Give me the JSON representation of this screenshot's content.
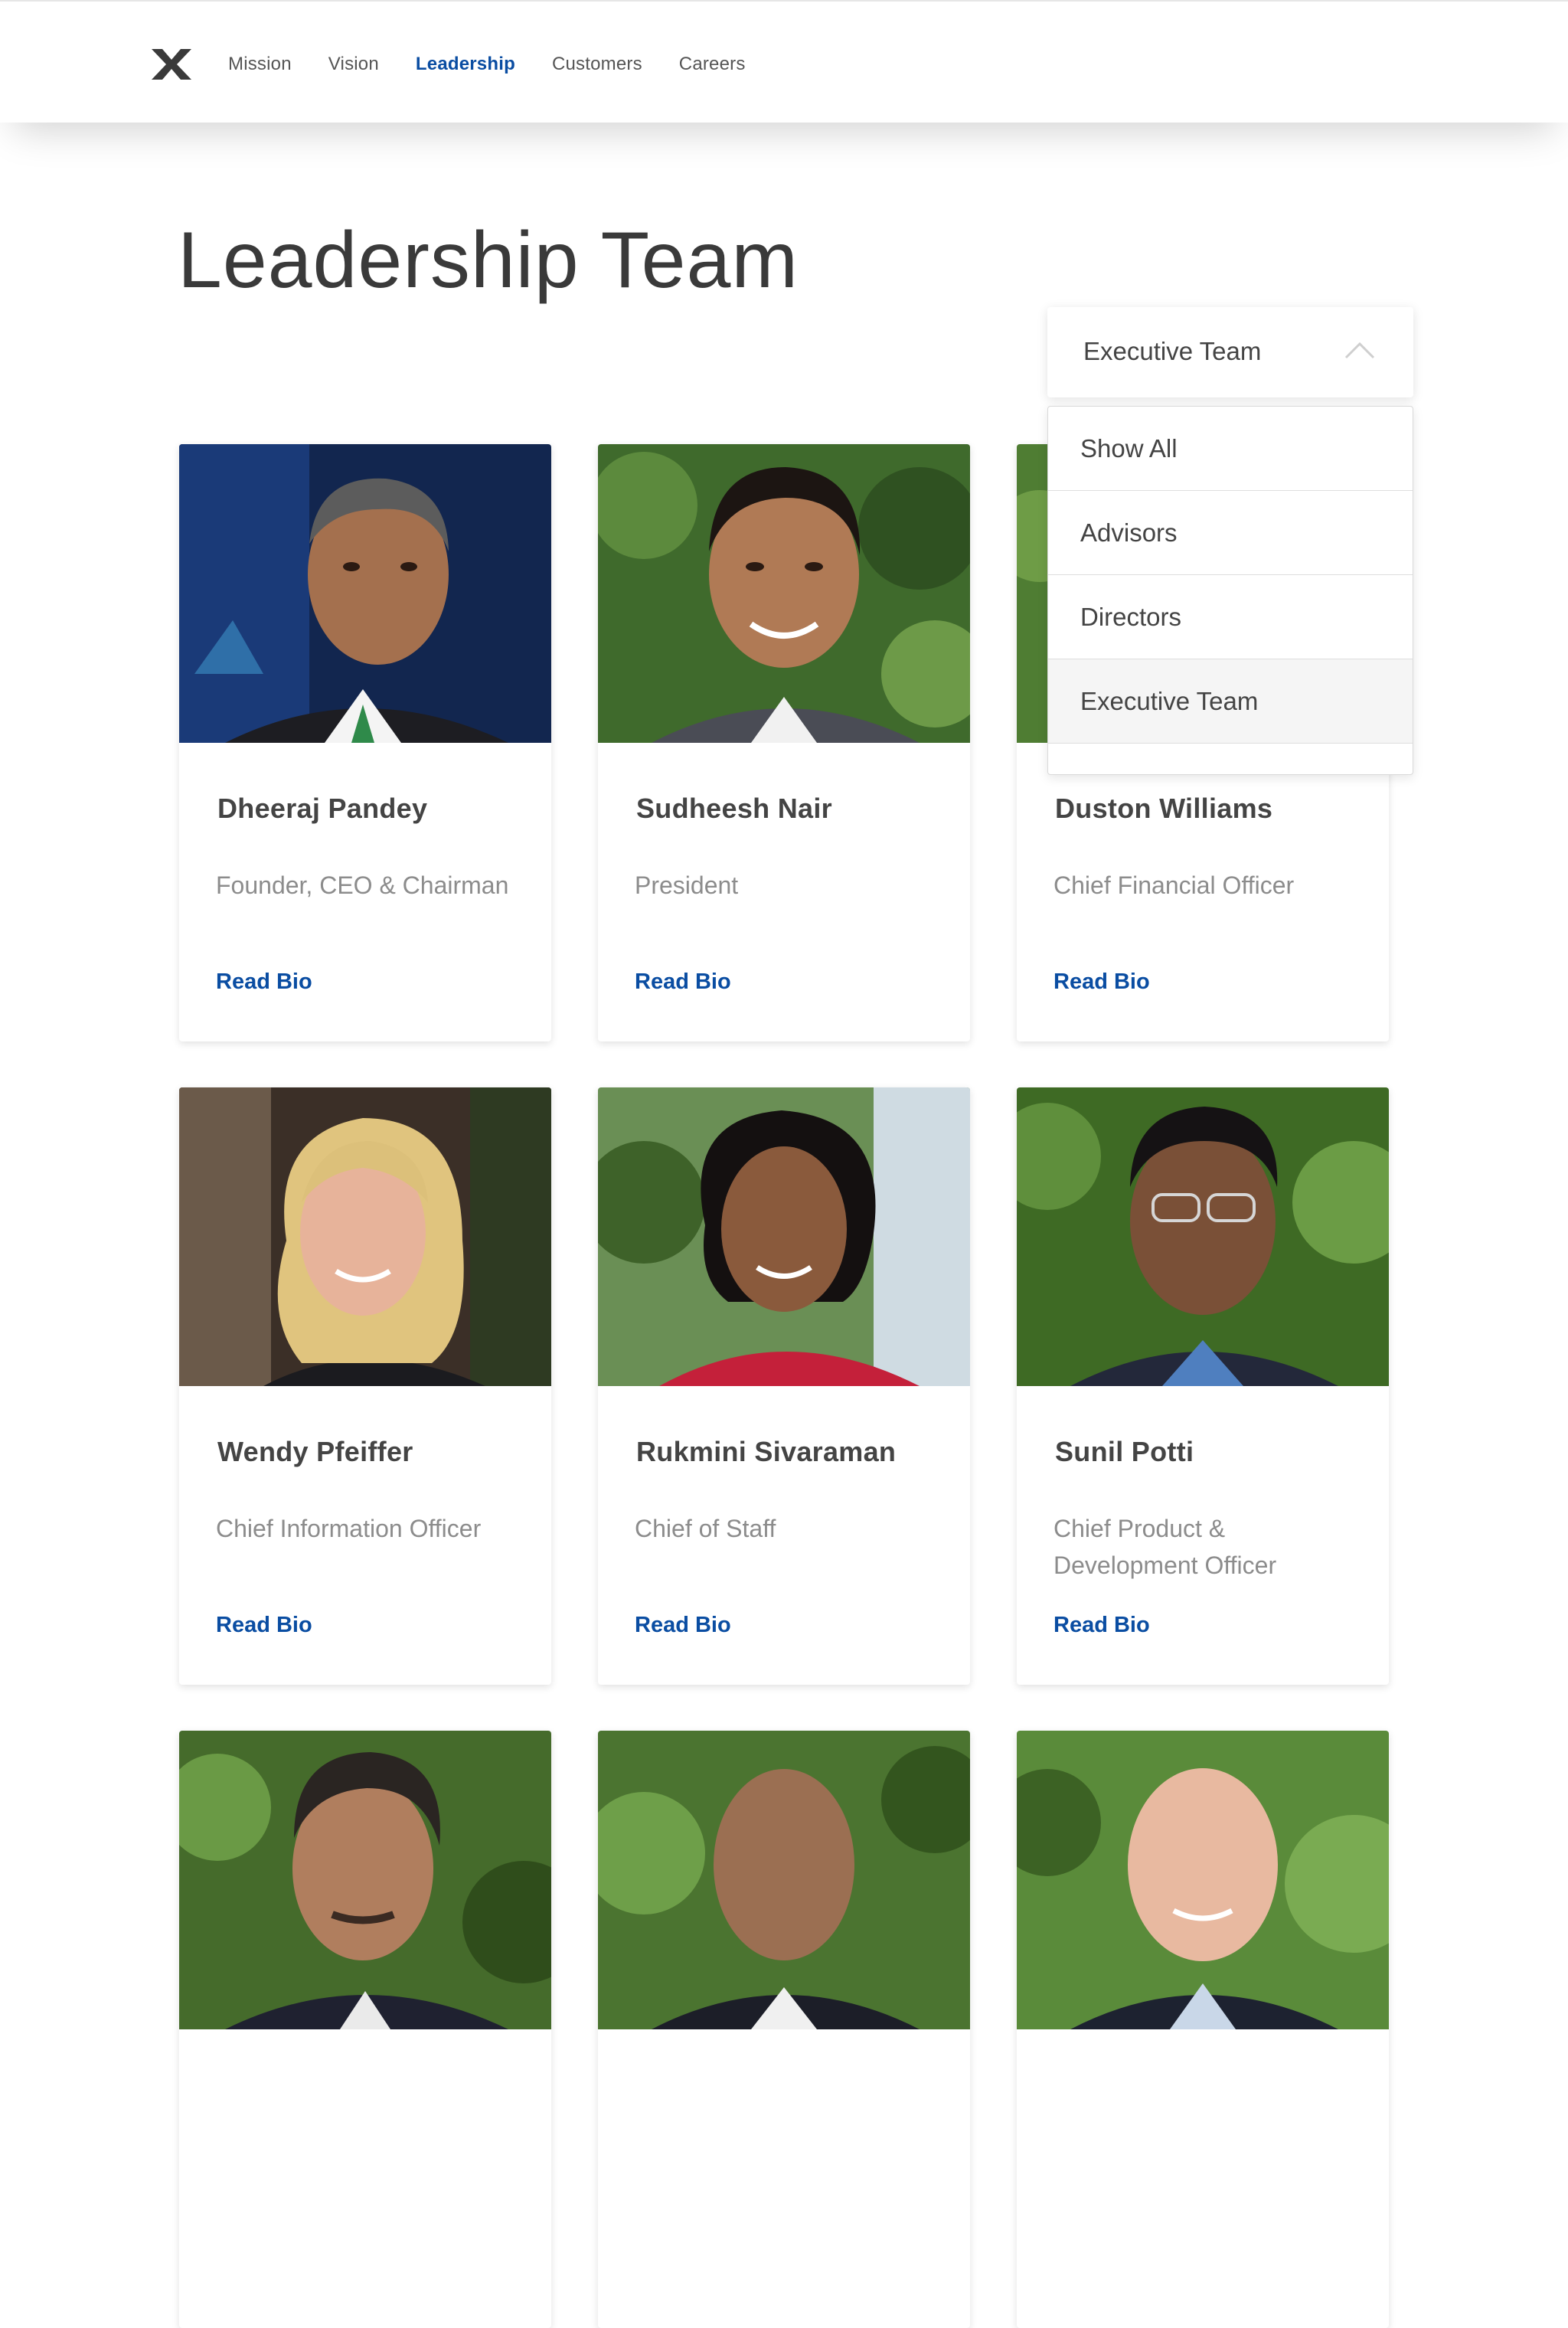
{
  "nav": {
    "logo": "nutanix-x-logo",
    "links": [
      "Mission",
      "Vision",
      "Leadership",
      "Customers",
      "Careers"
    ],
    "active": "Leadership"
  },
  "page": {
    "title": "Leadership Team"
  },
  "filter": {
    "selected": "Executive Team",
    "options": [
      "Show All",
      "Advisors",
      "Directors",
      "Executive Team"
    ],
    "icon": "chevron-up-icon"
  },
  "team": [
    {
      "name": "Dheeraj Pandey",
      "role": "Founder, CEO & Chairman",
      "link": "Read Bio"
    },
    {
      "name": "Sudheesh Nair",
      "role": "President",
      "link": "Read Bio"
    },
    {
      "name": "Duston Williams",
      "role": "Chief Financial Officer",
      "link": "Read Bio"
    },
    {
      "name": "Wendy Pfeiffer",
      "role": "Chief Information Officer",
      "link": "Read Bio"
    },
    {
      "name": "Rukmini Sivaraman",
      "role": "Chief of Staff",
      "link": "Read Bio"
    },
    {
      "name": "Sunil Potti",
      "role": "Chief Product & Development Officer",
      "link": "Read Bio"
    }
  ],
  "colors": {
    "accent": "#0a4da2",
    "text": "#444444",
    "muted": "#8c8c8c"
  }
}
